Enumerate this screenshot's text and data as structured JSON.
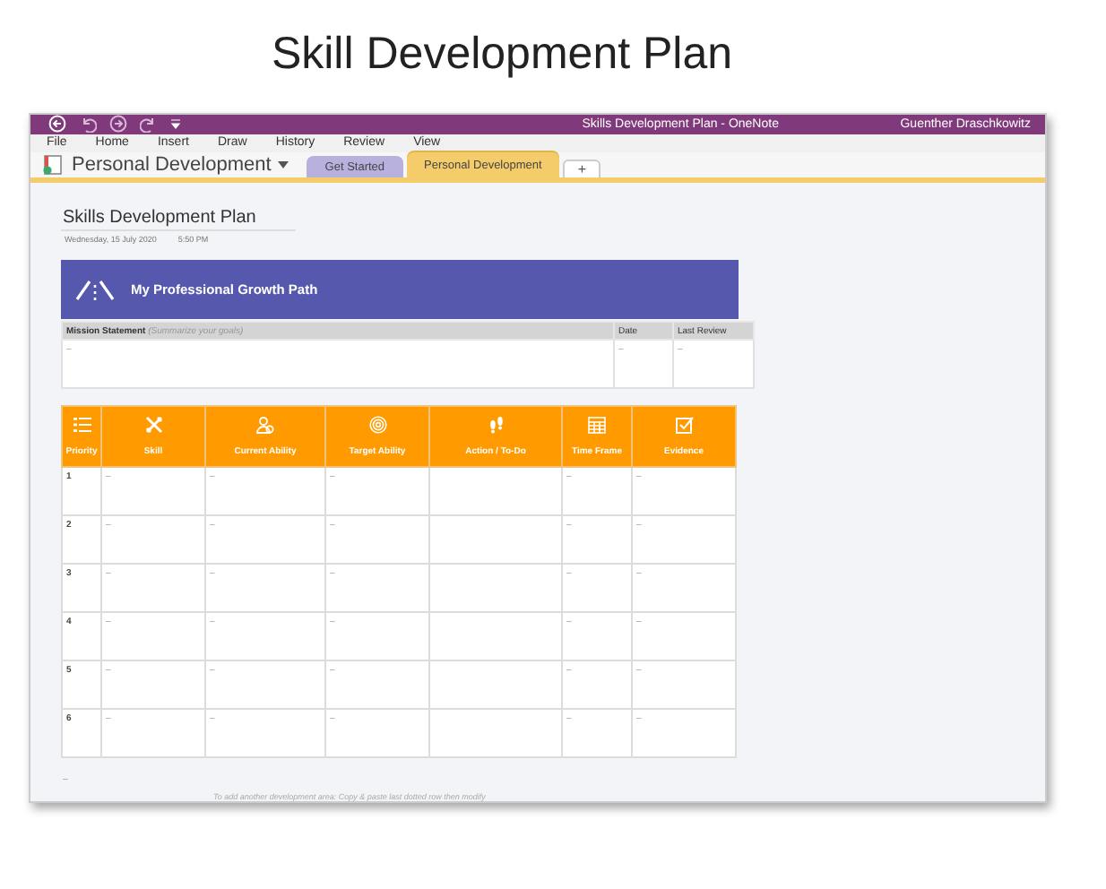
{
  "slide_title": "Skill Development Plan",
  "window": {
    "title": "Skills Development Plan  -  OneNote",
    "user": "Guenther Draschkowitz",
    "menu": [
      "File",
      "Home",
      "Insert",
      "Draw",
      "History",
      "Review",
      "View"
    ],
    "notebook": "Personal Development",
    "section_tabs": [
      {
        "label": "Get Started",
        "selected": false,
        "color": "#b9b1dd"
      },
      {
        "label": "Personal Development",
        "selected": true,
        "color": "#f4cc6a"
      }
    ],
    "new_tab": "+"
  },
  "page": {
    "title": "Skills Development Plan",
    "date": "Wednesday, 15 July 2020",
    "time": "5:50 PM",
    "banner": "My Professional Growth Path",
    "mission_table": {
      "columns": [
        "**Mission Statement** *(Summarize your goals)*",
        "Date",
        "Last Review"
      ],
      "row": [
        "–",
        "–",
        "–"
      ]
    },
    "table": {
      "columns": [
        "Priority",
        "Skill",
        "Current Ability",
        "Target Ability",
        "Action / To-Do",
        "Time Frame",
        "Evidence"
      ],
      "rows": [
        [
          "1",
          "–",
          "–",
          "–",
          null,
          "–",
          "–"
        ],
        [
          "2",
          "–",
          "–",
          "–",
          null,
          "–",
          "–"
        ],
        [
          "3",
          "–",
          "–",
          "–",
          null,
          "–",
          "–"
        ],
        [
          "4",
          "–",
          "–",
          "–",
          null,
          "–",
          "–"
        ],
        [
          "5",
          "–",
          "–",
          "–",
          null,
          "–",
          "–"
        ],
        [
          "6",
          "–",
          "–",
          "–",
          null,
          "–",
          "–"
        ]
      ]
    },
    "trailing_mark": "–",
    "note": "To add another development area: Copy & paste last dotted row then modify"
  }
}
